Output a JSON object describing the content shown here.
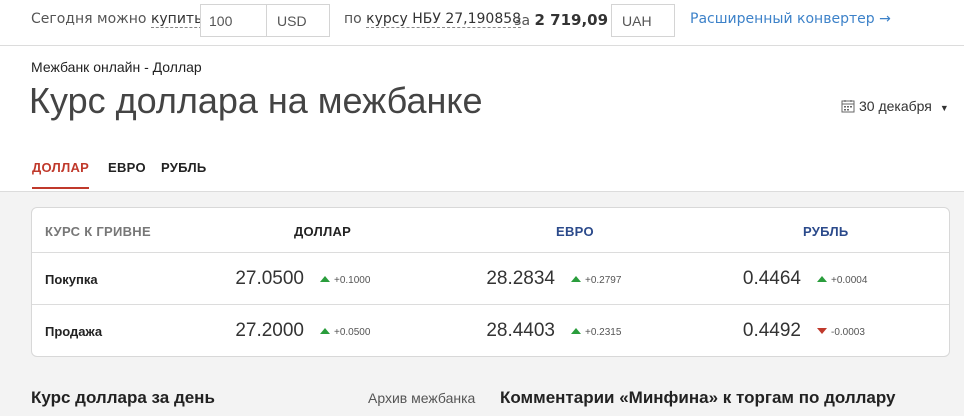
{
  "converter": {
    "today_can": "Сегодня можно",
    "buy": "купить",
    "amount": "100",
    "from_currency": "USD",
    "by": "по",
    "rate_link": "курсу НБУ 27,190858",
    "for": "за",
    "result": "2 719,09",
    "to_currency": "UAH",
    "advanced": "Расширенный конвертер →"
  },
  "header": {
    "breadcrumb": "Межбанк онлайн - Доллар",
    "title": "Курс доллара на межбанке",
    "date": "30 декабря"
  },
  "tabs": [
    {
      "label": "ДОЛЛАР",
      "active": true
    },
    {
      "label": "ЕВРО",
      "active": false
    },
    {
      "label": "РУБЛЬ",
      "active": false
    }
  ],
  "table": {
    "headers": [
      "КУРС К ГРИВНЕ",
      "ДОЛЛАР",
      "ЕВРО",
      "РУБЛЬ"
    ],
    "rows": [
      {
        "label": "Покупка",
        "usd": {
          "value": "27.0500",
          "change": "+0.1000",
          "dir": "up"
        },
        "eur": {
          "value": "28.2834",
          "change": "+0.2797",
          "dir": "up"
        },
        "rub": {
          "value": "0.4464",
          "change": "+0.0004",
          "dir": "up"
        }
      },
      {
        "label": "Продажа",
        "usd": {
          "value": "27.2000",
          "change": "+0.0500",
          "dir": "up"
        },
        "eur": {
          "value": "28.4403",
          "change": "+0.2315",
          "dir": "up"
        },
        "rub": {
          "value": "0.4492",
          "change": "-0.0003",
          "dir": "down"
        }
      }
    ]
  },
  "bottom": {
    "day_title": "Курс доллара за день",
    "archive": "Архив межбанка",
    "comments": "Комментарии «Минфина» к торгам по доллару"
  },
  "colors": {
    "accent": "#c0392b",
    "link": "#3d82c9",
    "up": "#2a9d3c",
    "down": "#c0392b",
    "euro_header": "#2b4a8b"
  }
}
